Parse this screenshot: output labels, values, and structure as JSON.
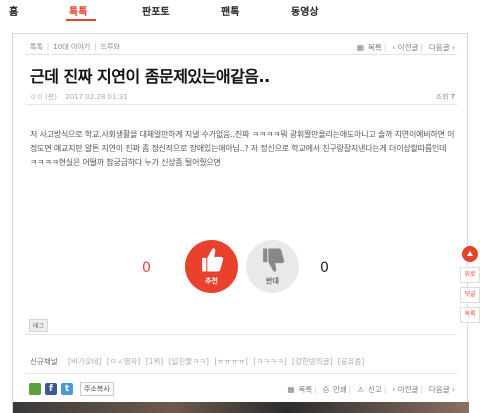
{
  "topnav": {
    "items": [
      "홈",
      "톡톡",
      "판포토",
      "팬톡",
      "동영상"
    ],
    "active": "톡톡"
  },
  "breadcrumb": [
    "톡톡",
    "10대 이야기",
    "드루와"
  ],
  "postnav": {
    "list": "목록",
    "prev": "이전글",
    "next": "다음글"
  },
  "post": {
    "title": "근데 진짜 지연이 좀문제있는애같음..",
    "author": "ㅇㅇ (판)",
    "date": "2017.02.28 01:31",
    "views_label": "조회",
    "views": "7",
    "body": "저 사고방식으로 학교.사회생활을 대체얼만하게 지낼 수가없음..진짜 ㅋㅋㅋㅋ뭐 광휘짤만올리는애도아니고 솔까 지연이예비하면 이정도면 얘교지만 얄튼 지연이 진짜 좀 정신적으로 장애있는애아님..? 저 정신으로 학교에서 친구랑잘지낸다는게 더이상할따름인데 ㅋㅋㅋㅋ현실은 어떨까 참궁금하다 누가 신상좀 털어줬으면"
  },
  "vote": {
    "up_count": "0",
    "up_label": "추천",
    "down_count": "0",
    "down_label": "반대",
    "up_color": "#e8412c",
    "down_color": "#e9e9e9"
  },
  "tag_label": "태그",
  "channels": {
    "label": "신규채널",
    "items": [
      "[비가오네]",
      "[ㅁㅅ영자]",
      "[1위]",
      "[일진물ㅋㅋ]",
      "[ㅠㅠㅠㅠ]",
      "[ㅋㅋㅋㅋ]",
      "[강한빙의글]",
      "[공유좀]"
    ]
  },
  "share": {
    "copy_url": "주소복사"
  },
  "bottomnav": {
    "list": "목록",
    "print": "인쇄",
    "report": "신고",
    "prev": "이전글",
    "next": "다음글"
  },
  "side": {
    "best": "위로",
    "comment": "댓글",
    "list": "목록"
  },
  "accent": "#e8412c"
}
